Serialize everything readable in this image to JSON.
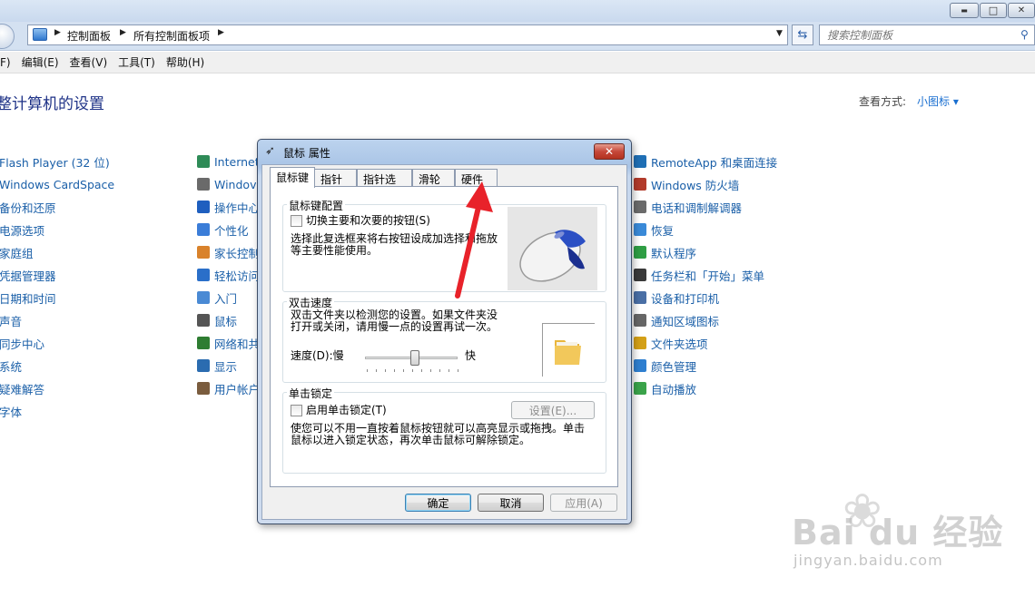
{
  "window": {
    "minimize_glyph": "▬",
    "maximize_glyph": "□",
    "close_glyph": "✕"
  },
  "address": {
    "crumbs": [
      "控制面板",
      "所有控制面板项"
    ],
    "separator": "▶"
  },
  "search": {
    "placeholder": "搜索控制面板"
  },
  "menu": [
    "F)",
    "编辑(E)",
    "查看(V)",
    "工具(T)",
    "帮助(H)"
  ],
  "heading": "整计算机的设置",
  "view": {
    "label": "查看方式:",
    "value": "小图标 ▾"
  },
  "columns": {
    "left": [
      "Flash Player (32 位)",
      "Windows CardSpace",
      "备份和还原",
      "电源选项",
      "家庭组",
      "凭据管理器",
      "日期和时间",
      "声音",
      "同步中心",
      "系统",
      "疑难解答",
      "字体"
    ],
    "middle": [
      "Internet",
      "Windov",
      "操作中心",
      "个性化",
      "家长控制",
      "轻松访问",
      "入门",
      "鼠标",
      "网络和共",
      "显示",
      "用户帐户"
    ],
    "right": [
      "RemoteApp 和桌面连接",
      "Windows 防火墙",
      "电话和调制解调器",
      "恢复",
      "默认程序",
      "任务栏和「开始」菜单",
      "设备和打印机",
      "通知区域图标",
      "文件夹选项",
      "颜色管理",
      "自动播放"
    ]
  },
  "icon_colors": {
    "middle": [
      "#2e8b57",
      "#6a6a6a",
      "#1f5fbf",
      "#3b7dd8",
      "#d9822b",
      "#2a6fc9",
      "#4a8ad4",
      "#555555",
      "#2e7d32",
      "#2b6cb0",
      "#7a5c3e"
    ],
    "right": [
      "#1f6fb5",
      "#b23b2b",
      "#6b6b6b",
      "#3a8ad8",
      "#2f9e44",
      "#3a3a3a",
      "#4a6fa5",
      "#666666",
      "#d4a017",
      "#2f7fd0",
      "#3aa34a"
    ]
  },
  "dialog": {
    "title": "鼠标 属性",
    "close_glyph": "✕",
    "tabs": [
      "鼠标键",
      "指针",
      "指针选项",
      "滑轮",
      "硬件"
    ],
    "button_config": {
      "group": "鼠标键配置",
      "checkbox": "切换主要和次要的按钮(S)",
      "desc_line1": "选择此复选框来将右按钮设成加选择和拖放",
      "desc_line2": "等主要性能使用。"
    },
    "double_click": {
      "group": "双击速度",
      "desc_line1": "双击文件夹以检测您的设置。如果文件夹没",
      "desc_line2": "打开或关闭，请用慢一点的设置再试一次。",
      "speed_label": "速度(D):慢",
      "fast_label": "快",
      "speed_value": 0.55
    },
    "click_lock": {
      "group": "单击锁定",
      "checkbox": "启用单击锁定(T)",
      "settings_button": "设置(E)...",
      "desc_line1": "使您可以不用一直按着鼠标按钮就可以高亮显示或拖拽。单击",
      "desc_line2": "鼠标以进入锁定状态，再次单击鼠标可解除锁定。"
    },
    "ok": "确定",
    "cancel": "取消",
    "apply": "应用(A)"
  },
  "annotation": {
    "arrow_color": "#e8222a"
  },
  "watermark": {
    "main": "Bai du 经验",
    "sub": "jingyan.baidu.com"
  }
}
